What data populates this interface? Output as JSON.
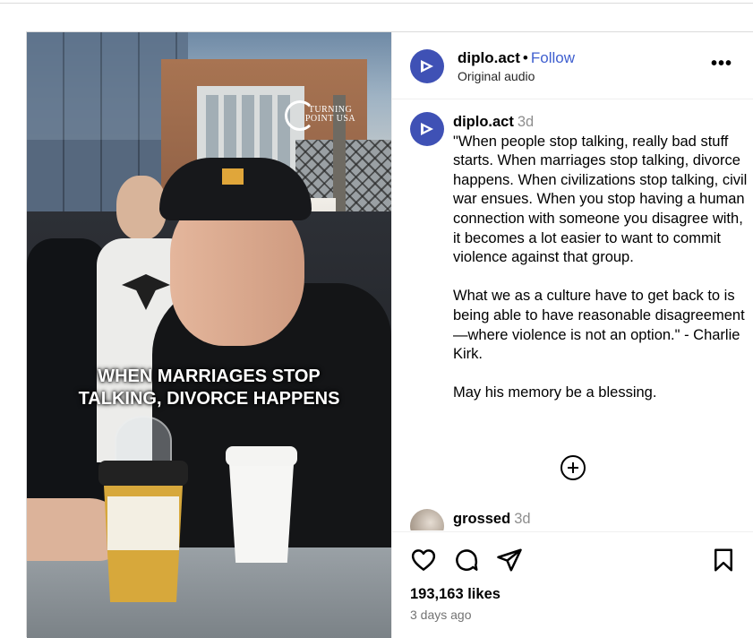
{
  "video": {
    "caption_line1": "WHEN MARRIAGES STOP",
    "caption_line2": "TALKING, DIVORCE HAPPENS",
    "watermark": "TURNING POINT USA"
  },
  "header": {
    "username": "diplo.act",
    "separator": "•",
    "follow_label": "Follow",
    "audio": "Original audio",
    "more_label": "•••"
  },
  "caption": {
    "username": "diplo.act",
    "time": "3d",
    "paragraphs": [
      "\"When people stop talking, really bad stuff starts. When marriages stop talking, divorce happens. When civilizations stop talking, civil war ensues. When you stop having a human connection with someone you disagree with, it becomes a lot easier to want to commit violence against that group.",
      "What we as a culture have to get back to is being able to have reasonable disagreement—where violence is not an option.\" - Charlie Kirk.",
      "May his memory be a blessing."
    ]
  },
  "comments": [
    {
      "username": "grossed",
      "time": "3d"
    }
  ],
  "actions": {
    "likes": "193,163 likes",
    "posted": "3 days ago"
  },
  "colors": {
    "accent": "#3f5fcf",
    "avatar": "#3f51b5",
    "muted": "#8e8e8e"
  },
  "icons": [
    "more-icon",
    "add-comment-icon",
    "heart-icon",
    "comment-icon",
    "share-icon",
    "bookmark-icon"
  ]
}
